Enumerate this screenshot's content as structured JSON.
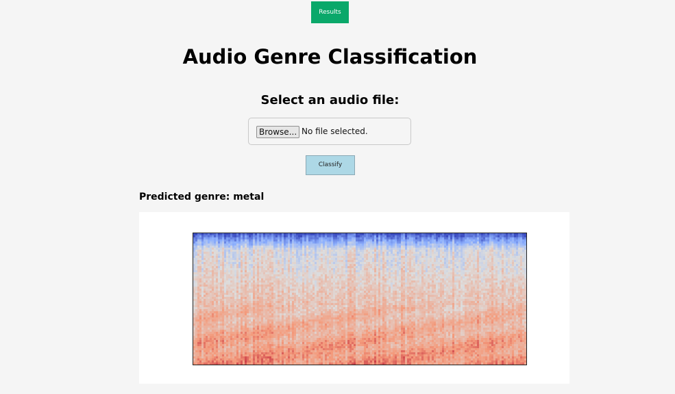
{
  "nav": {
    "results_label": "Results"
  },
  "header": {
    "title": "Audio Genre Classification"
  },
  "upload": {
    "prompt": "Select an audio file:",
    "browse_label": "Browse...",
    "status_text": "No file selected.",
    "classify_label": "Classify"
  },
  "result": {
    "predicted_text": "Predicted genre: metal",
    "spectrogram": {
      "icon": "mel-spectrogram-image",
      "colormap": "coolwarm",
      "colors": {
        "low": "#3b4cc0",
        "mid": "#dddddd",
        "high": "#b40426"
      }
    }
  },
  "colors": {
    "background": "#f5f5f5",
    "results_button": "#0aa86a",
    "classify_button": "#add8e6"
  }
}
